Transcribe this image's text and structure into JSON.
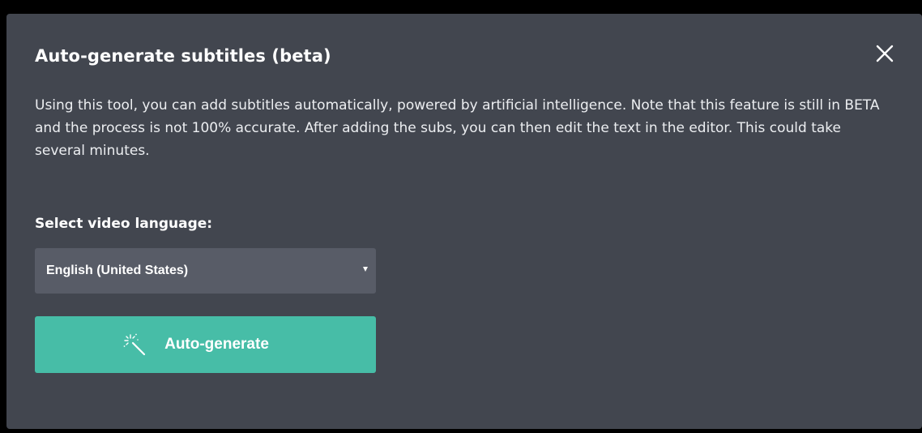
{
  "dialog": {
    "title": "Auto-generate subtitles (beta)",
    "description": "Using this tool, you can add subtitles automatically, powered by artificial intelligence. Note that this feature is still in BETA and the process is not 100% accurate. After adding the subs, you can then edit the text in the editor. This could take several minutes.",
    "close_icon": "close-icon"
  },
  "language": {
    "label": "Select video language:",
    "selected": "English (United States)"
  },
  "generate": {
    "label": "Auto-generate",
    "icon": "magic-wand-icon"
  },
  "colors": {
    "modal_bg": "#42464f",
    "select_bg": "#585c67",
    "accent": "#47bda7",
    "text": "#ffffff"
  }
}
